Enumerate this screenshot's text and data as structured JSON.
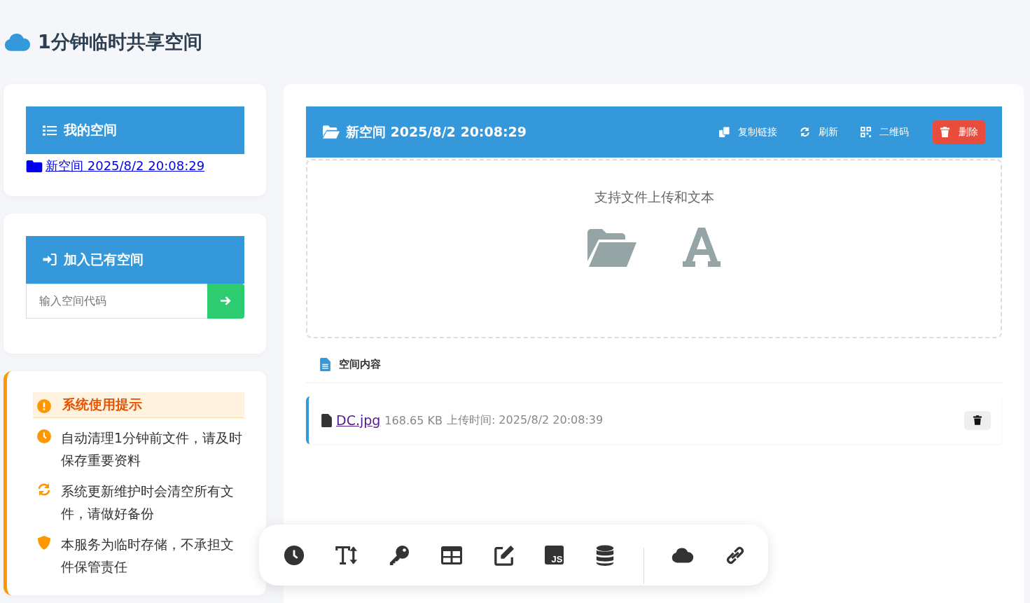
{
  "page_title": "1分钟临时共享空间",
  "my_spaces": {
    "title": "我的空间",
    "items": [
      {
        "label": "新空间 2025/8/2 20:08:29"
      }
    ]
  },
  "join_space": {
    "title": "加入已有空间",
    "placeholder": "输入空间代码"
  },
  "tips": {
    "title": "系统使用提示",
    "items": [
      {
        "kind": "clock",
        "text": "自动清理1分钟前文件，请及时保存重要资料"
      },
      {
        "kind": "sync",
        "text": "系统更新维护时会清空所有文件，请做好备份"
      },
      {
        "kind": "shield",
        "text": "本服务为临时存储，不承担文件保管责任"
      }
    ]
  },
  "space": {
    "title": "新空间 2025/8/2 20:08:29",
    "actions": [
      {
        "kind": "copy",
        "label": "复制链接"
      },
      {
        "kind": "refresh",
        "label": "刷新"
      },
      {
        "kind": "qr",
        "label": "二维码"
      },
      {
        "kind": "delete",
        "label": "删除"
      }
    ],
    "upload_hint": "支持文件上传和文本",
    "content_title": "空间内容",
    "files": [
      {
        "name": "DC.jpg",
        "size": "168.65 KB",
        "uploaded": "上传时间: 2025/8/2 20:08:39"
      }
    ]
  },
  "toolbar": [
    {
      "kind": "clock"
    },
    {
      "kind": "text-height"
    },
    {
      "kind": "key"
    },
    {
      "kind": "table"
    },
    {
      "kind": "edit"
    },
    {
      "kind": "js",
      "label": "JS"
    },
    {
      "kind": "database"
    },
    {
      "kind": "divider"
    },
    {
      "kind": "cloud"
    },
    {
      "kind": "link"
    }
  ]
}
